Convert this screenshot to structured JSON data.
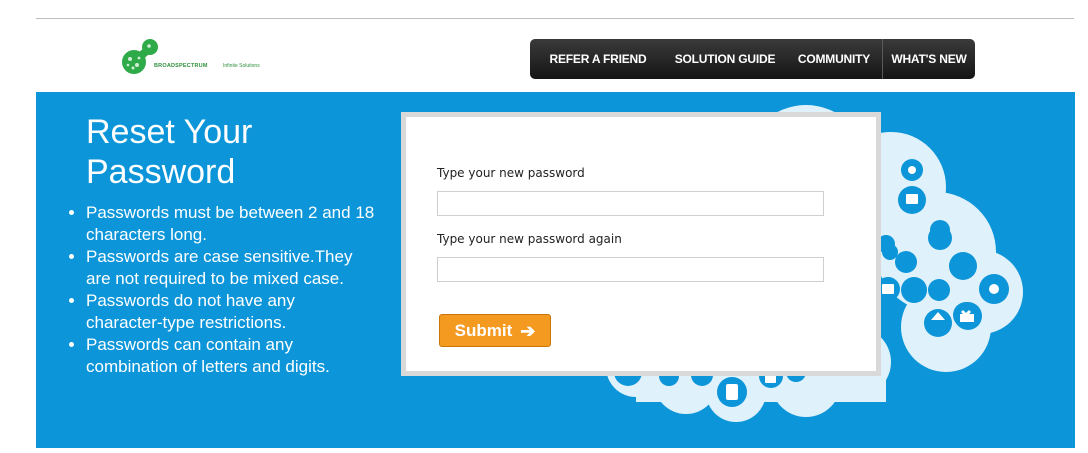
{
  "header": {
    "logo": {
      "name": "BROADSPECTRUM",
      "tagline": "Infinite Solutions"
    },
    "nav": [
      "REFER A FRIEND",
      "SOLUTION GUIDE",
      "COMMUNITY",
      "WHAT'S NEW"
    ]
  },
  "banner": {
    "title": "Reset Your Password",
    "rules": [
      "Passwords must be between 2 and 18 characters long.",
      "Passwords are case sensitive.They are not required to be mixed case.",
      "Passwords do not have any character-type restrictions.",
      "Passwords can contain any combination of letters and digits."
    ]
  },
  "form": {
    "password_label": "Type your new password",
    "password_value": "",
    "confirm_label": "Type your new password again",
    "confirm_value": "",
    "submit_label": "Submit"
  },
  "colors": {
    "banner": "#0c95d9",
    "button": "#f59a20",
    "nav": "#1e1e1e",
    "brand": "#2f8f3e"
  },
  "icons": [
    "logo-mark",
    "cloud-illustration",
    "arrow-right-icon"
  ]
}
